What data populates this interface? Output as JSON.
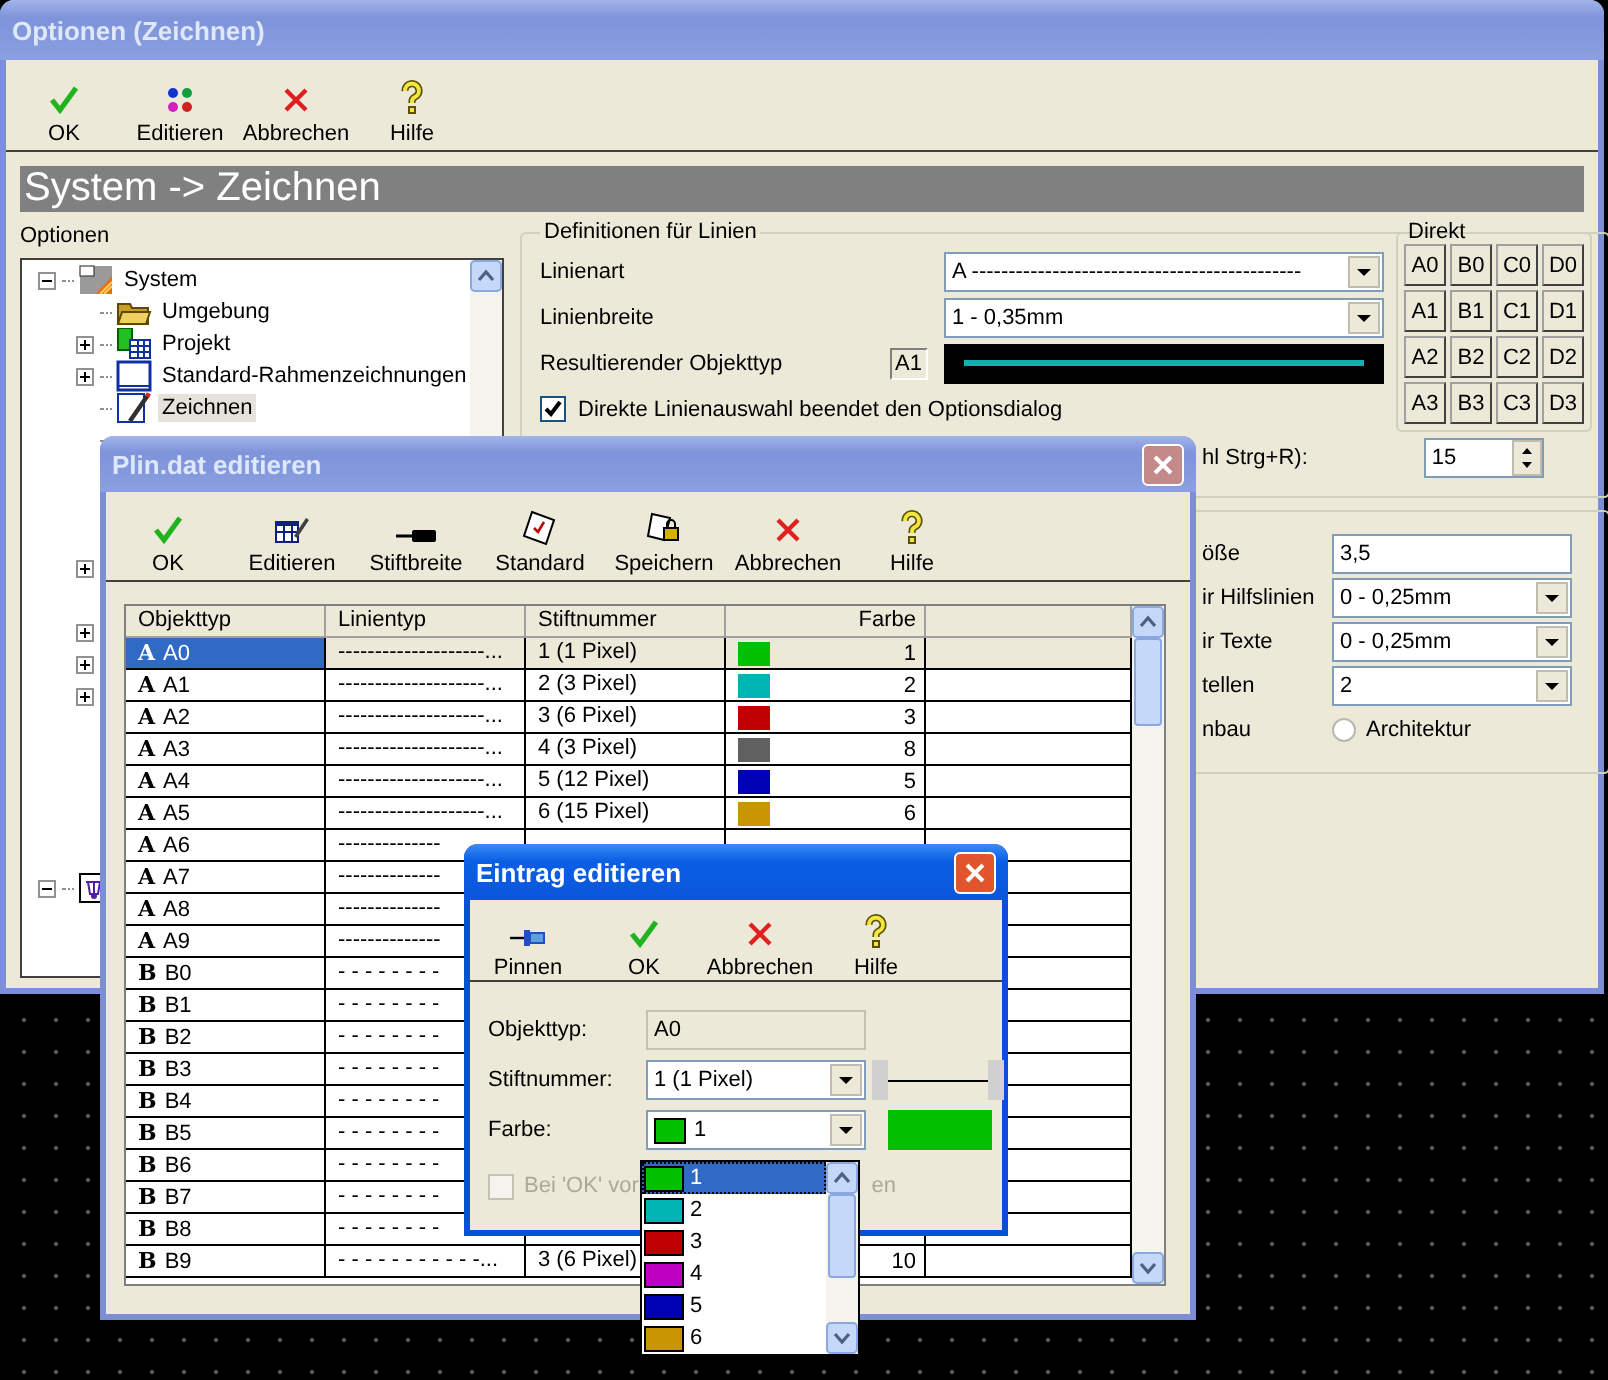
{
  "main_window": {
    "title": "Optionen (Zeichnen)",
    "toolbar": [
      {
        "kind": "ok",
        "label": "OK"
      },
      {
        "kind": "dots",
        "label": "Editieren"
      },
      {
        "kind": "cancel",
        "label": "Abbrechen"
      },
      {
        "kind": "help",
        "label": "Hilfe"
      }
    ],
    "breadcrumb": "System -> Zeichnen",
    "tree_label": "Optionen",
    "tree": [
      {
        "kind": "system",
        "label": "System",
        "expanded": true,
        "selected": false,
        "children": [
          {
            "kind": "folder",
            "label": "Umgebung",
            "selected": false
          },
          {
            "kind": "project",
            "label": "Projekt",
            "expanded": false,
            "selected": false
          },
          {
            "kind": "frame",
            "label": "Standard-Rahmenzeichnungen",
            "expanded": false,
            "selected": false
          },
          {
            "kind": "drawing",
            "label": "Zeichnen",
            "selected": true
          },
          {
            "kind": "covered"
          },
          {
            "kind": "covered"
          },
          {
            "kind": "covered"
          },
          {
            "kind": "covered"
          },
          {
            "kind": "covered",
            "expanded": false
          },
          {
            "kind": "covered"
          },
          {
            "kind": "covered",
            "expanded": false
          },
          {
            "kind": "covered",
            "expanded": false
          },
          {
            "kind": "covered",
            "expanded": false
          },
          {
            "kind": "covered"
          },
          {
            "kind": "covered"
          },
          {
            "kind": "covered"
          },
          {
            "kind": "covered"
          },
          {
            "kind": "covered"
          }
        ]
      },
      {
        "kind": "document",
        "expanded": true,
        "children": [
          {
            "kind": "covered"
          },
          {
            "kind": "covered"
          }
        ]
      }
    ],
    "line_settings": {
      "legend": "Definitionen für Linien",
      "fields": [
        {
          "kind": "combo",
          "label": "Linienart",
          "value": "A ---------------------------------------------"
        },
        {
          "kind": "combo",
          "label": "Linienbreite",
          "value": "1 - 0,35mm"
        },
        {
          "kind": "preview",
          "label": "Resultierender Objekttyp",
          "value": "A1"
        }
      ],
      "checkbox": {
        "label": "Direkte Linienauswahl beendet den Optionsdialog",
        "checked": true
      },
      "direct": {
        "legend": "Direkt",
        "buttons": [
          "A0",
          "B0",
          "C0",
          "D0",
          "A1",
          "B1",
          "C1",
          "D1",
          "A2",
          "B2",
          "C2",
          "D2",
          "A3",
          "B3",
          "C3",
          "D3"
        ]
      },
      "shortcut": {
        "label": "hl Strg+R):",
        "value": "15"
      }
    },
    "text_settings": {
      "rows": [
        {
          "kind": "input",
          "label": "öße",
          "value": "3,5"
        },
        {
          "kind": "combo",
          "label": "ir Hilfslinien",
          "value": "0 - 0,25mm"
        },
        {
          "kind": "combo",
          "label": "ir Texte",
          "value": "0 - 0,25mm"
        },
        {
          "kind": "combo",
          "label": "tellen",
          "value": "2"
        },
        {
          "kind": "radio",
          "label": "nbau",
          "value": "Architektur",
          "selected": false
        }
      ]
    }
  },
  "plin_window": {
    "title": "Plin.dat editieren",
    "toolbar": [
      {
        "kind": "ok",
        "label": "OK"
      },
      {
        "kind": "table-edit",
        "label": "Editieren"
      },
      {
        "kind": "pen",
        "label": "Stiftbreite"
      },
      {
        "kind": "standard",
        "label": "Standard"
      },
      {
        "kind": "save",
        "label": "Speichern"
      },
      {
        "kind": "cancel",
        "label": "Abbrechen"
      },
      {
        "kind": "help",
        "label": "Hilfe"
      }
    ],
    "columns": [
      "Objekttyp",
      "Linientyp",
      "Stiftnummer",
      "Farbe"
    ],
    "rows": [
      {
        "glyph": "A",
        "name": "A0",
        "linetype": "--------------------...",
        "pen": "1 (1 Pixel)",
        "color": "#00c000",
        "number": "1",
        "selected": true
      },
      {
        "glyph": "A",
        "name": "A1",
        "linetype": "--------------------...",
        "pen": "2 (3 Pixel)",
        "color": "#00b4b4",
        "number": "2",
        "selected": false
      },
      {
        "glyph": "A",
        "name": "A2",
        "linetype": "--------------------...",
        "pen": "3 (6 Pixel)",
        "color": "#c00000",
        "number": "3",
        "selected": false
      },
      {
        "glyph": "A",
        "name": "A3",
        "linetype": "--------------------...",
        "pen": "4 (3 Pixel)",
        "color": "#606060",
        "number": "8",
        "selected": false
      },
      {
        "glyph": "A",
        "name": "A4",
        "linetype": "--------------------...",
        "pen": "5 (12 Pixel)",
        "color": "#0000b4",
        "number": "5",
        "selected": false
      },
      {
        "glyph": "A",
        "name": "A5",
        "linetype": "--------------------...",
        "pen": "6 (15 Pixel)",
        "color": "#c89600",
        "number": "6",
        "selected": false
      },
      {
        "glyph": "A",
        "name": "A6",
        "linetype": "--------------",
        "selected": false
      },
      {
        "glyph": "A",
        "name": "A7",
        "linetype": "--------------",
        "selected": false
      },
      {
        "glyph": "A",
        "name": "A8",
        "linetype": "--------------",
        "selected": false
      },
      {
        "glyph": "A",
        "name": "A9",
        "linetype": "--------------",
        "selected": false
      },
      {
        "glyph": "B",
        "name": "B0",
        "linetype": "- - - - - - - -",
        "selected": false
      },
      {
        "glyph": "B",
        "name": "B1",
        "linetype": "- - - - - - - -",
        "selected": false
      },
      {
        "glyph": "B",
        "name": "B2",
        "linetype": "- - - - - - - -",
        "selected": false
      },
      {
        "glyph": "B",
        "name": "B3",
        "linetype": "- - - - - - - -",
        "selected": false
      },
      {
        "glyph": "B",
        "name": "B4",
        "linetype": "- - - - - - - -",
        "selected": false
      },
      {
        "glyph": "B",
        "name": "B5",
        "linetype": "- - - - - - - -",
        "selected": false
      },
      {
        "glyph": "B",
        "name": "B6",
        "linetype": "- - - - - - - -",
        "selected": false
      },
      {
        "glyph": "B",
        "name": "B7",
        "linetype": "- - - - - - - -",
        "selected": false
      },
      {
        "glyph": "B",
        "name": "B8",
        "linetype": "- - - - - - - -",
        "selected": false
      },
      {
        "glyph": "B",
        "name": "B9",
        "linetype": "- - - - - - - - - - -...",
        "pen": "3 (6 Pixel)",
        "number": "10",
        "selected": false
      }
    ]
  },
  "entry_dialog": {
    "title": "Eintrag editieren",
    "toolbar": [
      {
        "kind": "pin",
        "label": "Pinnen"
      },
      {
        "kind": "ok",
        "label": "OK"
      },
      {
        "kind": "cancel",
        "label": "Abbrechen"
      },
      {
        "kind": "help",
        "label": "Hilfe"
      }
    ],
    "objekttyp": {
      "label": "Objekttyp:",
      "value": "A0"
    },
    "stiftnummer": {
      "label": "Stiftnummer:",
      "value": "1 (1 Pixel)"
    },
    "farbe": {
      "label": "Farbe:",
      "value": "1",
      "color": "#00c000"
    },
    "checkbox": {
      "label": "Bei 'OK' vor",
      "tail": "en",
      "checked": false,
      "disabled": true
    },
    "color_list": [
      {
        "value": "1",
        "color": "#00c000",
        "selected": true
      },
      {
        "value": "2",
        "color": "#00b4b4",
        "selected": false
      },
      {
        "value": "3",
        "color": "#c00000",
        "selected": false
      },
      {
        "value": "4",
        "color": "#c000c0",
        "selected": false
      },
      {
        "value": "5",
        "color": "#0000b4",
        "selected": false
      },
      {
        "value": "6",
        "color": "#c89600",
        "selected": false
      }
    ]
  }
}
